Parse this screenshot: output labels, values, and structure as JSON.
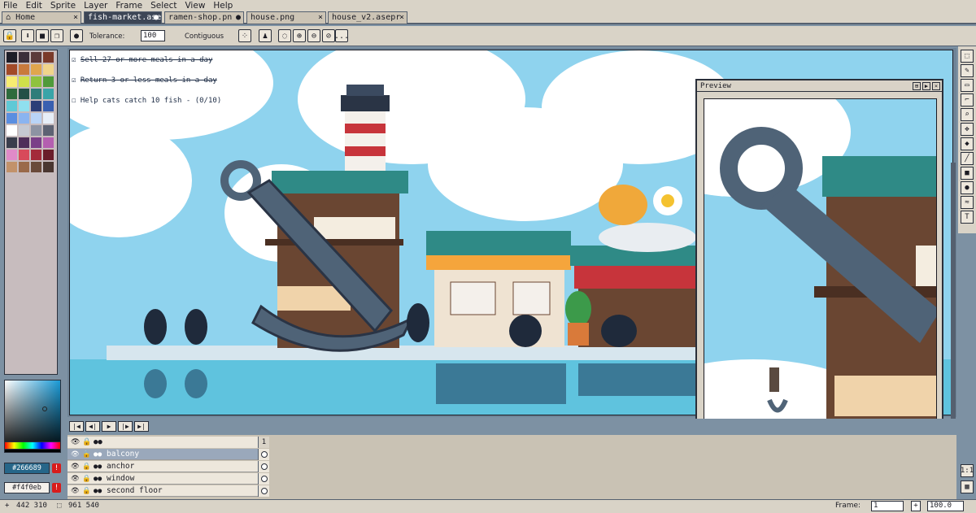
{
  "menu": [
    "File",
    "Edit",
    "Sprite",
    "Layer",
    "Frame",
    "Select",
    "View",
    "Help"
  ],
  "tabs": [
    {
      "label": "Home",
      "active": false,
      "closer": "×"
    },
    {
      "label": "fish-market.ase",
      "active": true,
      "closer": "●"
    },
    {
      "label": "ramen-shop.pn",
      "active": false,
      "closer": "●"
    },
    {
      "label": "house.png",
      "active": false,
      "closer": "×"
    },
    {
      "label": "house_v2.asepr",
      "active": false,
      "closer": "×"
    }
  ],
  "toolbar": {
    "tolerance_label": "Tolerance:",
    "tolerance_value": "100",
    "contiguous_label": "Contiguous",
    "more": "..."
  },
  "objectives": [
    {
      "text": "Sell 27 or more meals in a day",
      "done": true
    },
    {
      "text": "Return 3 or less meals in a day",
      "done": true
    },
    {
      "text": "Help cats catch 10 fish - (0/10)",
      "done": false
    }
  ],
  "colors": {
    "foreground": "#266689",
    "background": "#f4f0eb",
    "accent": "#3d4656",
    "palette": [
      "#1d1d27",
      "#3b2e3a",
      "#5b3a3a",
      "#7a3a2a",
      "#a24a28",
      "#c97a3c",
      "#e0a64d",
      "#f0d48a",
      "#f7ec71",
      "#cfe04a",
      "#8fc23e",
      "#4f9a3a",
      "#2e6b3c",
      "#235047",
      "#2f7d7a",
      "#3aa4a8",
      "#5fc9d6",
      "#8fe0ef",
      "#2c3e78",
      "#3a5fb0",
      "#5a8ee0",
      "#8ab4f0",
      "#b9d4f7",
      "#e7eef8",
      "#ffffff",
      "#c5c9d2",
      "#8d93a3",
      "#5d6273",
      "#3a3e4c",
      "#4f2f5a",
      "#7a3f88",
      "#b45fb0",
      "#e08ac8",
      "#d84a5a",
      "#a32b3a",
      "#6a1d2a",
      "#c2926a",
      "#9a6a4a",
      "#6a4a3a",
      "#4a3630"
    ]
  },
  "fg_label": "#266689",
  "bg_label": "#f4f0eb",
  "preview": {
    "title": "Preview"
  },
  "timeline": {
    "frame_number": "1",
    "layers": [
      {
        "name": "balcony",
        "selected": true
      },
      {
        "name": "anchor",
        "selected": false
      },
      {
        "name": "window",
        "selected": false
      },
      {
        "name": "second floor",
        "selected": false
      }
    ]
  },
  "status": {
    "cursor": "442 310",
    "size": "961 540",
    "frame_label": "Frame:",
    "frame_value": "1",
    "zoom": "100.0"
  },
  "icons": [
    "lock-icon",
    "download-icon",
    "stop-icon",
    "copy-icon",
    "circle-icon",
    "pencil-icon",
    "eraser-icon",
    "eyedropper-icon",
    "zoom-icon",
    "move-icon",
    "fill-icon",
    "line-icon",
    "rectangle-icon",
    "ellipse-icon",
    "blur-icon",
    "text-icon",
    "eye-icon",
    "warning-icon"
  ]
}
